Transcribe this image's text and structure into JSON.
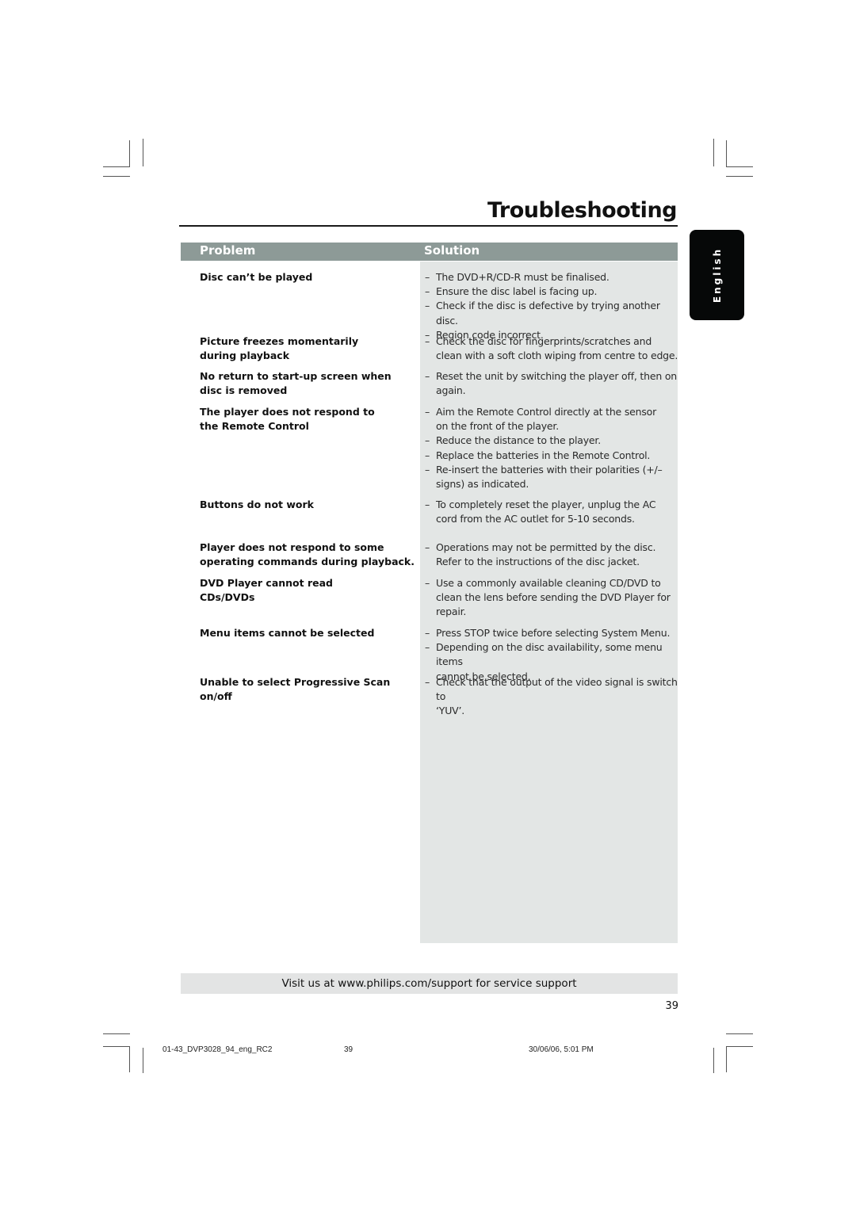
{
  "page": {
    "title": "Troubleshooting",
    "language_tab": "English",
    "header": {
      "problem": "Problem",
      "solution": "Solution"
    },
    "colors": {
      "header_bar": "#8d9a97",
      "solution_bg": "#e3e6e5",
      "language_tab": "#060808"
    },
    "rows": [
      {
        "problem": [
          "Disc can’t be played"
        ],
        "solutions": [
          [
            "The DVD+R/CD-R must be finalised."
          ],
          [
            "Ensure the disc label is facing up."
          ],
          [
            "Check if the disc is defective by trying another disc."
          ],
          [
            "Region code incorrect."
          ]
        ]
      },
      {
        "problem": [
          "Picture freezes momentarily",
          "during playback"
        ],
        "solutions": [
          [
            "Check the disc for fingerprints/scratches and",
            "clean with a soft cloth wiping from centre to edge."
          ]
        ]
      },
      {
        "problem": [
          "No return to start-up screen when",
          "disc is removed"
        ],
        "solutions": [
          [
            "Reset the unit by switching the player off, then on",
            "again."
          ]
        ]
      },
      {
        "problem": [
          "The player does not respond to",
          "the Remote Control"
        ],
        "solutions": [
          [
            "Aim the Remote Control directly at the sensor",
            "on the front of the player."
          ],
          [
            "Reduce the distance to the player."
          ],
          [
            "Replace the batteries in the Remote Control."
          ],
          [
            "Re-insert the batteries with their polarities (+/–",
            "signs) as indicated."
          ]
        ]
      },
      {
        "problem": [
          "Buttons do not work"
        ],
        "solutions": [
          [
            "To completely reset the player, unplug the AC",
            "cord from the AC outlet for 5-10 seconds."
          ]
        ]
      },
      {
        "problem": [
          "Player does not respond to some",
          "operating commands during playback."
        ],
        "solutions": [
          [
            "Operations may not be permitted by the disc.",
            "Refer to the instructions of  the disc jacket."
          ]
        ]
      },
      {
        "problem": [
          "DVD Player cannot read",
          "CDs/DVDs"
        ],
        "solutions": [
          [
            "Use a commonly available cleaning CD/DVD to",
            "clean the lens before sending the DVD Player for",
            "repair."
          ]
        ]
      },
      {
        "problem": [
          "Menu items cannot be selected"
        ],
        "solutions": [
          [
            "Press STOP twice before selecting System Menu."
          ],
          [
            "Depending on the disc availability, some menu items",
            "cannot be selected."
          ]
        ]
      },
      {
        "problem": [
          "Unable to select Progressive Scan on/off"
        ],
        "solutions": [
          [
            "Check that the output of the video signal is switch to",
            "‘YUV’."
          ]
        ]
      }
    ],
    "dash": "–",
    "support_text": "Visit us at www.philips.com/support for service support",
    "page_number": "39",
    "slug": {
      "file": "01-43_DVP3028_94_eng_RC2",
      "page": "39",
      "date": "30/06/06, 5:01 PM"
    }
  }
}
